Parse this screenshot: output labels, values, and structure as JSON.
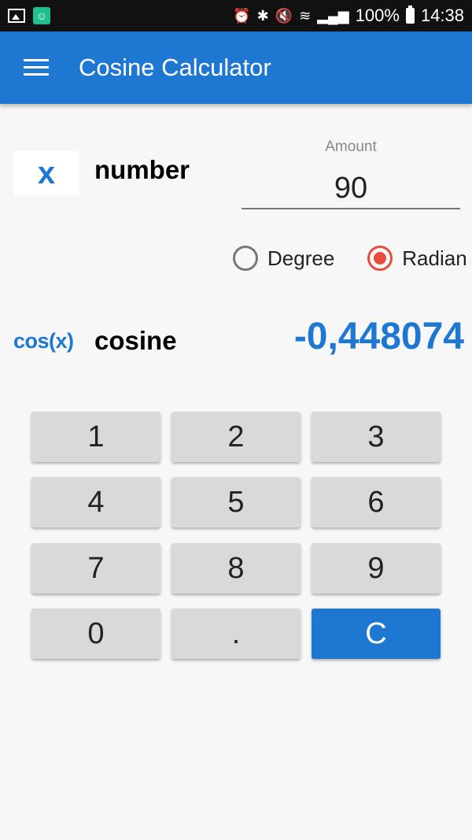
{
  "status_bar": {
    "battery": "100%",
    "time": "14:38"
  },
  "app_bar": {
    "title": "Cosine Calculator"
  },
  "input": {
    "icon_letter": "x",
    "label": "number",
    "caption": "Amount",
    "value": "90"
  },
  "unit": {
    "options": [
      "Degree",
      "Radian"
    ],
    "selected": "Radian"
  },
  "output": {
    "function_label": "cos(x)",
    "label": "cosine",
    "value": "-0,448074"
  },
  "keypad": {
    "keys": [
      "1",
      "2",
      "3",
      "4",
      "5",
      "6",
      "7",
      "8",
      "9",
      "0",
      ".",
      "C"
    ]
  },
  "colors": {
    "accent": "#1e78d2",
    "radio_selected": "#e84c3d"
  }
}
